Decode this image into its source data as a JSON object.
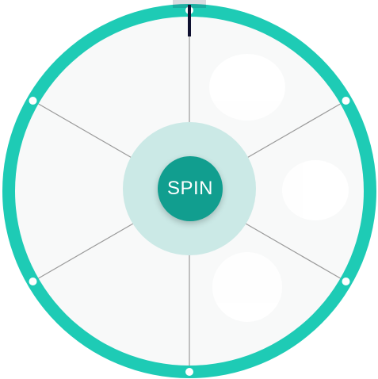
{
  "wheel": {
    "segment_count": 6,
    "segment_labels": [
      "",
      "",
      "",
      "",
      "",
      ""
    ],
    "pin_count": 6
  },
  "spin_button": {
    "label": "SPIN"
  },
  "colors": {
    "rim": "#1ecbb5",
    "face": "#f8f9f9",
    "divider": "#9a9a9a",
    "pin": "#ffffff",
    "hub_glow": "#cbe9e6",
    "button": "#119e8f",
    "button_text": "#ffffff",
    "pointer": "#0f1030"
  },
  "icons": {
    "pointer": "pointer-icon"
  }
}
